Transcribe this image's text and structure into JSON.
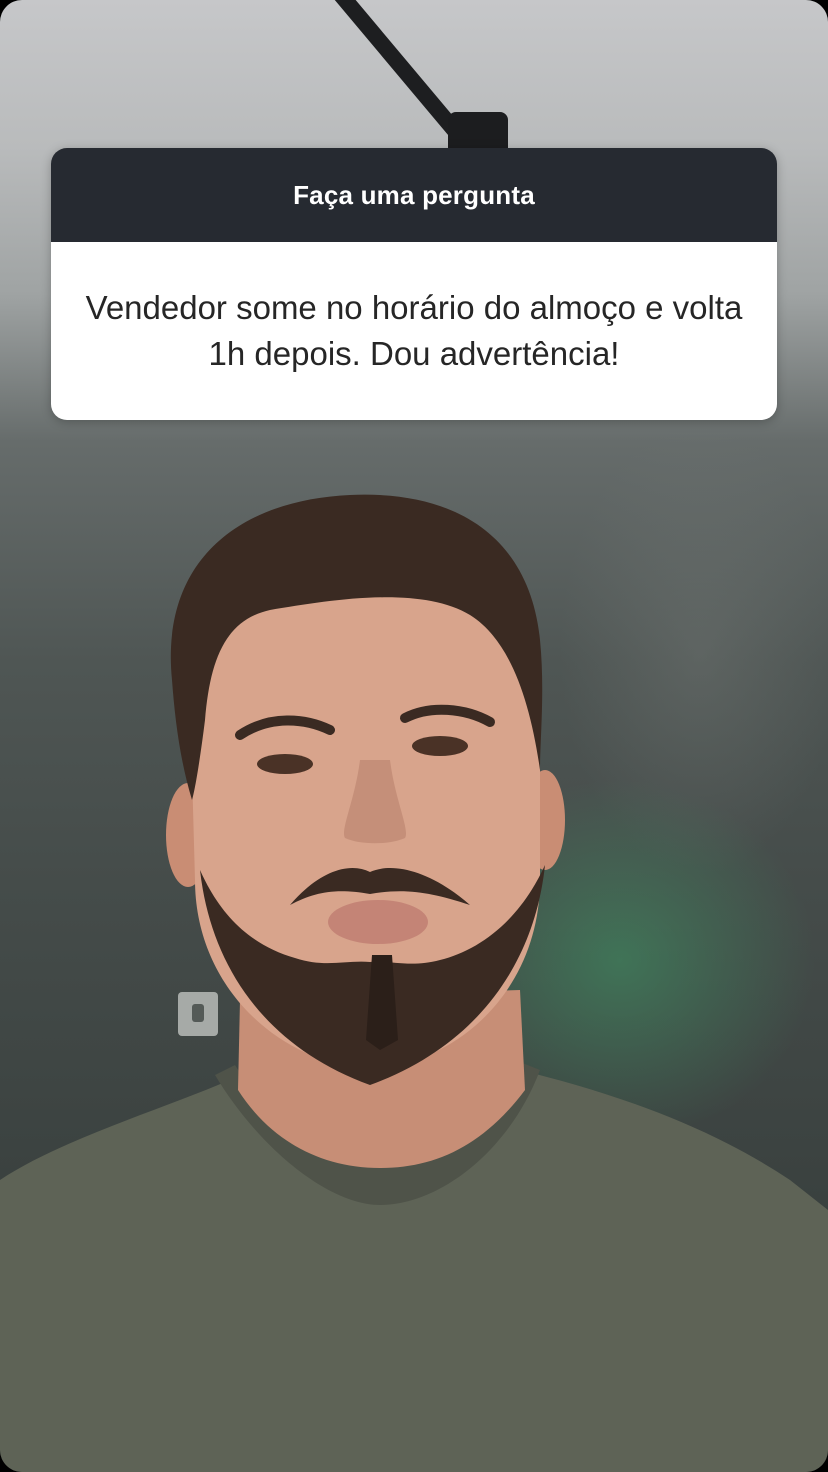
{
  "story": {
    "question_sticker": {
      "header": "Faça uma pergunta",
      "answer": "Vendedor some no horário do almoço e volta 1h depois. Dou advertência!"
    }
  },
  "colors": {
    "sticker_header_bg": "#262a31",
    "sticker_body_bg": "#ffffff",
    "sticker_header_text": "#ffffff",
    "sticker_body_text": "#262626",
    "wall": "#454c4a",
    "ceiling": "#c6c7c9",
    "green_light": "#3e9664",
    "shirt": "#5e6356",
    "skin": "#d8a48c",
    "hair": "#3a2a22"
  }
}
